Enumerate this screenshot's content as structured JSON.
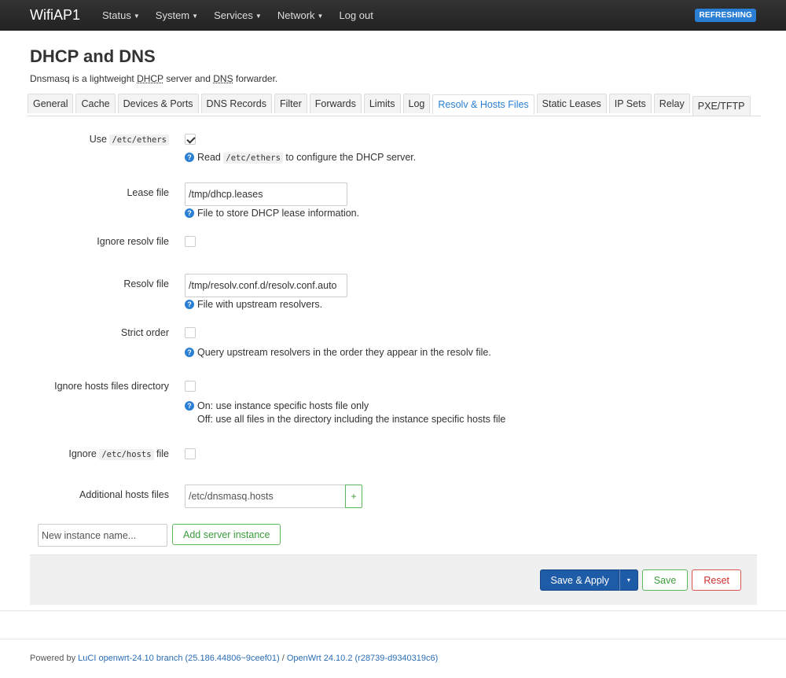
{
  "header": {
    "brand": "WifiAP1",
    "nav": [
      {
        "label": "Status",
        "has_menu": true
      },
      {
        "label": "System",
        "has_menu": true
      },
      {
        "label": "Services",
        "has_menu": true
      },
      {
        "label": "Network",
        "has_menu": true
      },
      {
        "label": "Log out",
        "has_menu": false
      }
    ],
    "badge": "REFRESHING",
    "badge_color": "#2a7fd4"
  },
  "page": {
    "title": "DHCP and DNS",
    "description_pre": "Dnsmasq is a lightweight ",
    "description_abbr1": "DHCP",
    "description_mid": " server and ",
    "description_abbr2": "DNS",
    "description_post": " forwarder."
  },
  "tabs": [
    {
      "label": "General",
      "active": false
    },
    {
      "label": "Cache",
      "active": false
    },
    {
      "label": "Devices & Ports",
      "active": false
    },
    {
      "label": "DNS Records",
      "active": false
    },
    {
      "label": "Filter",
      "active": false
    },
    {
      "label": "Forwards",
      "active": false
    },
    {
      "label": "Limits",
      "active": false
    },
    {
      "label": "Log",
      "active": false
    },
    {
      "label": "Resolv & Hosts Files",
      "active": true
    },
    {
      "label": "Static Leases",
      "active": false
    },
    {
      "label": "IP Sets",
      "active": false
    },
    {
      "label": "Relay",
      "active": false
    },
    {
      "label": "PXE/TFTP",
      "active": false
    }
  ],
  "form": {
    "use_ethers": {
      "label_pre": "Use",
      "label_code": "/etc/ethers",
      "checked": true,
      "help_pre": "Read",
      "help_code": "/etc/ethers",
      "help_post": "to configure the DHCP server."
    },
    "lease_file": {
      "label": "Lease file",
      "value": "/tmp/dhcp.leases",
      "help": "File to store DHCP lease information."
    },
    "ignore_resolv": {
      "label": "Ignore resolv file",
      "checked": false
    },
    "resolv_file": {
      "label": "Resolv file",
      "value": "/tmp/resolv.conf.d/resolv.conf.auto",
      "help": "File with upstream resolvers."
    },
    "strict_order": {
      "label": "Strict order",
      "checked": false,
      "help": "Query upstream resolvers in the order they appear in the resolv file."
    },
    "ignore_hosts_dir": {
      "label": "Ignore hosts files directory",
      "checked": false,
      "help_line1": "On: use instance specific hosts file only",
      "help_line2": "Off: use all files in the directory including the instance specific hosts file"
    },
    "ignore_etc_hosts": {
      "label_pre": "Ignore",
      "label_code": "/etc/hosts",
      "label_post": "file",
      "checked": false
    },
    "additional_hosts": {
      "label": "Additional hosts files",
      "placeholder": "/etc/dnsmasq.hosts",
      "add_label": "+"
    }
  },
  "instance": {
    "placeholder": "New instance name...",
    "add_label": "Add server instance"
  },
  "actions": {
    "save_apply": "Save & Apply",
    "dropdown": "▾",
    "save": "Save",
    "reset": "Reset"
  },
  "footer": {
    "prefix": "Powered by ",
    "luci_link": "LuCI openwrt-24.10 branch (25.186.44806~9ceef01)",
    "separator": " / ",
    "openwrt_link": "OpenWrt 24.10.2 (r28739-d9340319c6)"
  }
}
